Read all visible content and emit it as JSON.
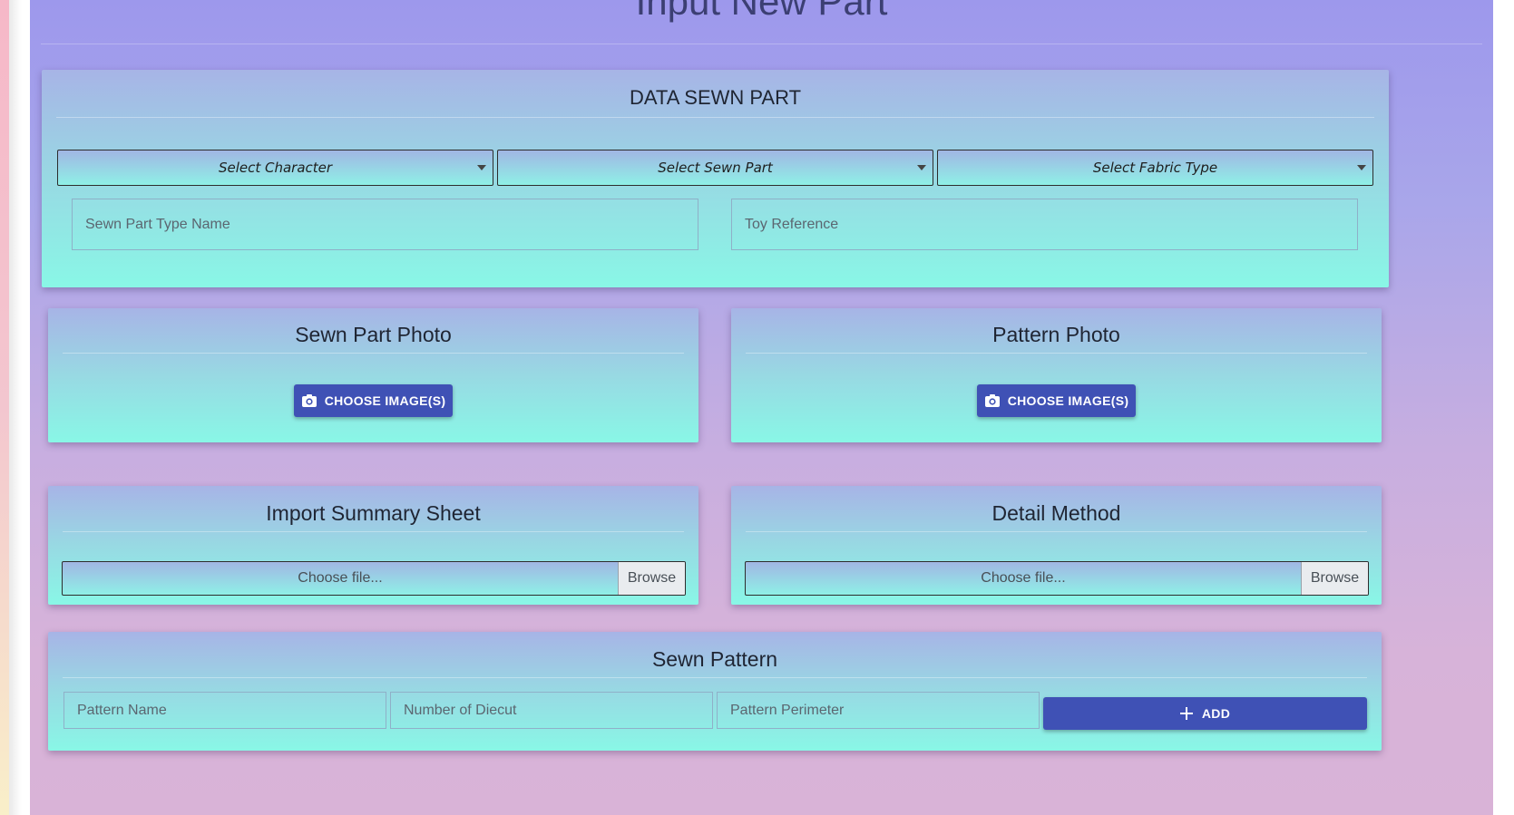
{
  "page": {
    "title": "Input New Part"
  },
  "data_sewn_part": {
    "title": "DATA SEWN PART",
    "selects": {
      "character": "Select Character",
      "sewn_part": "Select Sewn Part",
      "fabric_type": "Select Fabric Type"
    },
    "inputs": {
      "sewn_part_type_name": "Sewn Part Type Name",
      "toy_reference": "Toy Reference"
    }
  },
  "sewn_part_photo": {
    "title": "Sewn Part Photo",
    "button": "CHOOSE IMAGE(S)"
  },
  "pattern_photo": {
    "title": "Pattern Photo",
    "button": "CHOOSE IMAGE(S)"
  },
  "import_summary_sheet": {
    "title": "Import Summary Sheet",
    "file_label": "Choose file...",
    "browse": "Browse"
  },
  "detail_method": {
    "title": "Detail Method",
    "file_label": "Choose file...",
    "browse": "Browse"
  },
  "sewn_pattern": {
    "title": "Sewn Pattern",
    "inputs": {
      "pattern_name": "Pattern Name",
      "number_of_diecut": "Number of Diecut",
      "pattern_perimeter": "Pattern Perimeter"
    },
    "add_button": "ADD"
  },
  "icons": {
    "camera": "camera-icon",
    "plus": "plus-icon",
    "caret": "chevron-down-icon"
  },
  "colors": {
    "primary_button": "#3f51b5",
    "page_gradient_top": "#9d98ec",
    "page_gradient_bottom": "#d9b3d7",
    "card_gradient_top": "#a7b4e6",
    "card_gradient_bottom": "#89f7e6"
  }
}
